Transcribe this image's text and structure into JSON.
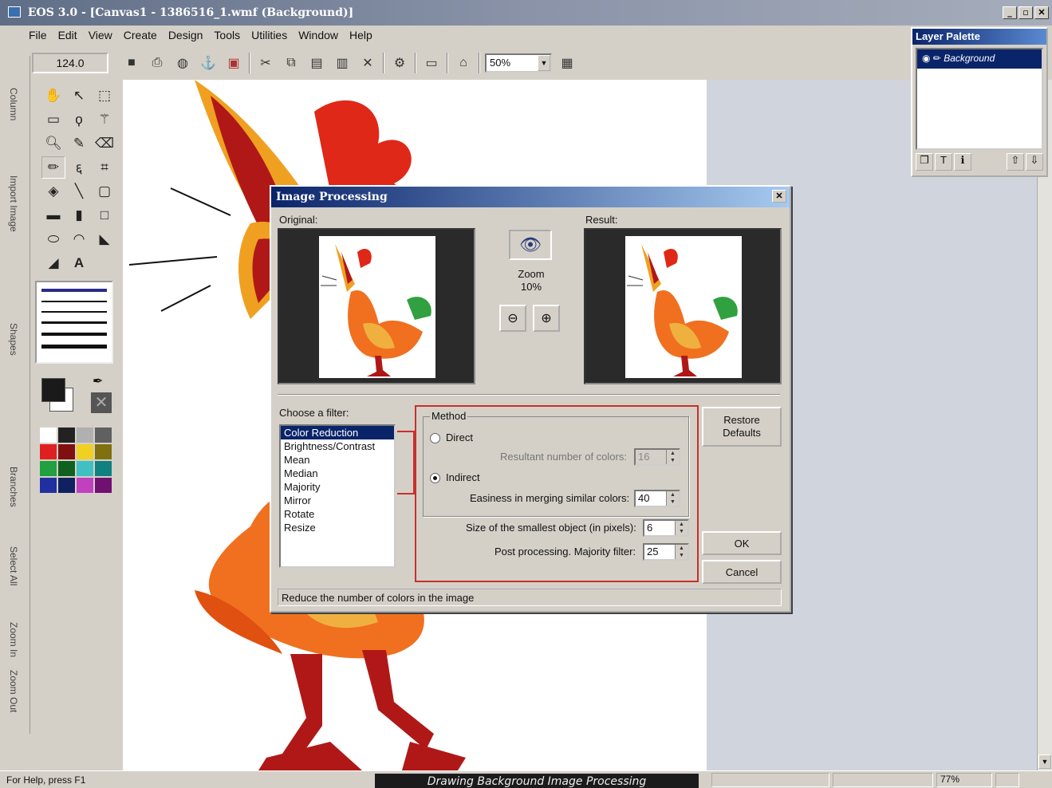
{
  "window": {
    "title": "EOS 3.0 - [Canvas1 - 1386516_1.wmf (Background)]",
    "min": "_",
    "max": "▫",
    "close": "✕"
  },
  "menu": [
    "File",
    "Edit",
    "View",
    "Create",
    "Design",
    "Tools",
    "Utilities",
    "Window",
    "Help"
  ],
  "toolbar": {
    "size_value": "124.0",
    "zoom_value": "50%"
  },
  "side_tabs": [
    "Column",
    "Import Image",
    "Shapes",
    "Branches",
    "Select All",
    "Zoom In",
    "Zoom Out"
  ],
  "layer_palette": {
    "title": "Layer Palette",
    "layer_name": "Background"
  },
  "dialog": {
    "title": "Image Processing",
    "original_label": "Original:",
    "result_label": "Result:",
    "zoom_label": "Zoom",
    "zoom_value": "10%",
    "filter_label": "Choose a filter:",
    "filters": [
      "Color Reduction",
      "Brightness/Contrast",
      "Mean",
      "Median",
      "Majority",
      "Mirror",
      "Rotate",
      "Resize"
    ],
    "selected_filter": 0,
    "method_label": "Method",
    "direct_label": "Direct",
    "resultant_label": "Resultant number of colors:",
    "resultant_value": "16",
    "indirect_label": "Indirect",
    "easiness_label": "Easiness in merging similar colors:",
    "easiness_value": "40",
    "smallest_label": "Size of the smallest object (in pixels):",
    "smallest_value": "6",
    "post_label": "Post processing. Majority filter:",
    "post_value": "25",
    "restore_label": "Restore Defaults",
    "ok_label": "OK",
    "cancel_label": "Cancel",
    "status": "Reduce the number of colors in the image"
  },
  "statusbar": {
    "help": "For Help, press F1",
    "zoom": "77%"
  },
  "caption": "Drawing Background Image Processing",
  "colors": {
    "accent": "#0a246a",
    "highlight": "#c8302c"
  }
}
